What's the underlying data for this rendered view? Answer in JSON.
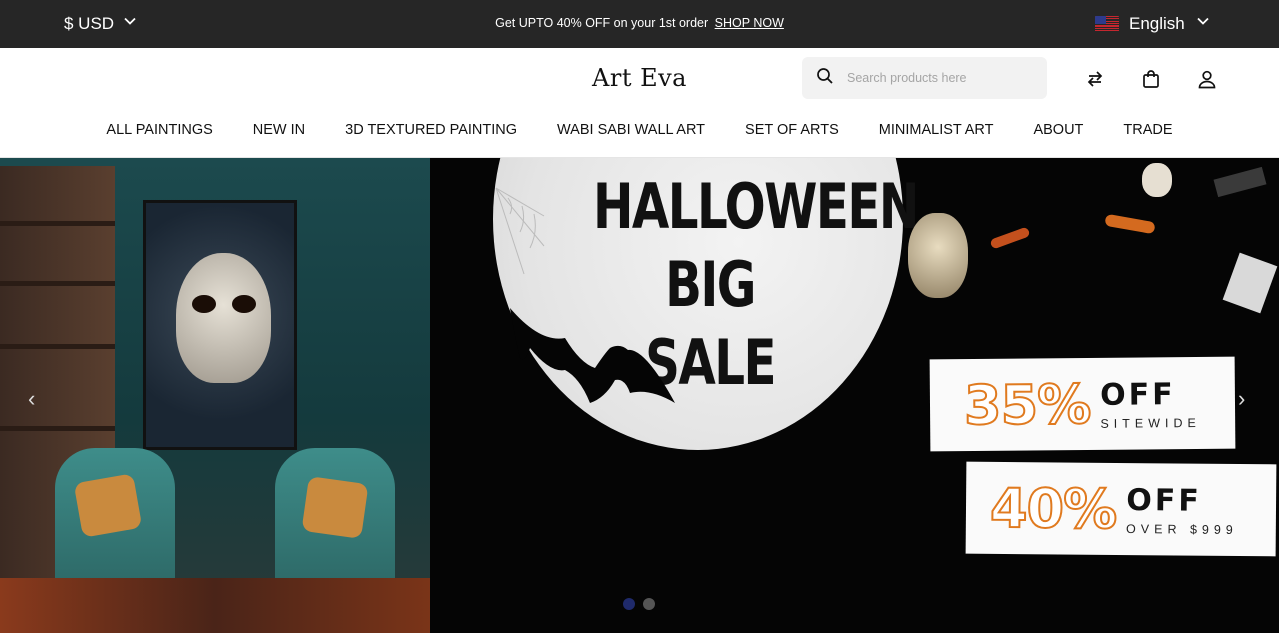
{
  "topbar": {
    "currency": "$ USD",
    "promo_text": "Get UPTO 40% OFF on your 1st order",
    "promo_link": "SHOP NOW",
    "language": "English"
  },
  "header": {
    "logo": "Art Eva",
    "search_placeholder": "Search products here"
  },
  "nav": [
    "ALL PAINTINGS",
    "NEW IN",
    "3D TEXTURED PAINTING",
    "WABI SABI WALL ART",
    "SET OF ARTS",
    "MINIMALIST ART",
    "ABOUT",
    "TRADE"
  ],
  "hero": {
    "title_line1": "HALLOWEEN",
    "title_line2": "BIG SALE",
    "offer1_pct": "35%",
    "offer1_off": "OFF",
    "offer1_sub": "SITEWIDE",
    "offer2_pct": "40%",
    "offer2_off": "OFF",
    "offer2_sub": "OVER $999",
    "slides_total": 2,
    "active_slide": 1
  },
  "colors": {
    "topbar_bg": "#262626",
    "accent_orange": "#e07a1f",
    "active_dot": "#1f2a6b",
    "inactive_dot": "#555555"
  }
}
